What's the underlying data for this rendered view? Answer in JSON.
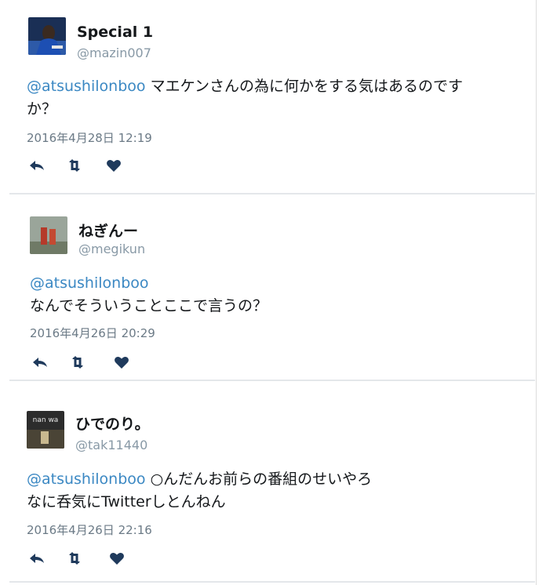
{
  "tweets": [
    {
      "name": "Special 1",
      "handle": "@mazin007",
      "mention": "@atsushilonboo",
      "text_line1": "マエケンさんの為に何かをする気はあるのです",
      "text_line2": "か？",
      "timestamp": "2016年4月28日 12:19"
    },
    {
      "name": "ねぎんー",
      "handle": "@megikun",
      "mention": "@atsushilonboo",
      "text_line1": "",
      "text_line2": "なんでそういうことここで言うの？",
      "timestamp": "2016年4月26日 20:29"
    },
    {
      "name": "ひでのり。",
      "handle": "@tak11440",
      "mention": "@atsushilonboo",
      "text_line1": "○んだんお前らの番組のせいやろ",
      "text_line2": "なに呑気にTwitterしとんねん",
      "timestamp": "2016年4月26日 22:16",
      "avatar_text": "nan wa"
    }
  ],
  "icons": {
    "reply": "reply-icon",
    "retweet": "retweet-icon",
    "like": "heart-icon"
  },
  "colors": {
    "mention": "#3b88c3",
    "meta": "#8899a6",
    "action": "#1f3a5c"
  }
}
